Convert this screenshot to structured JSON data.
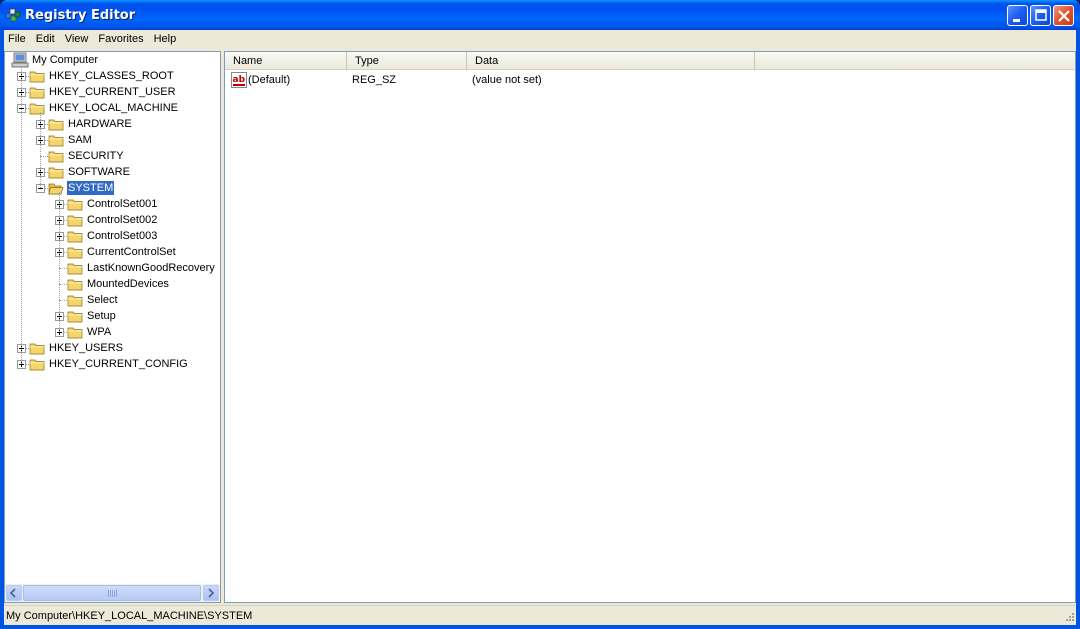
{
  "window": {
    "title": "Registry Editor"
  },
  "menu": [
    "File",
    "Edit",
    "View",
    "Favorites",
    "Help"
  ],
  "tree": {
    "root": "My Computer",
    "nodes": [
      {
        "label": "HKEY_CLASSES_ROOT",
        "depth": 1,
        "expander": "plus"
      },
      {
        "label": "HKEY_CURRENT_USER",
        "depth": 1,
        "expander": "plus"
      },
      {
        "label": "HKEY_LOCAL_MACHINE",
        "depth": 1,
        "expander": "minus"
      },
      {
        "label": "HARDWARE",
        "depth": 2,
        "expander": "plus"
      },
      {
        "label": "SAM",
        "depth": 2,
        "expander": "plus"
      },
      {
        "label": "SECURITY",
        "depth": 2,
        "expander": "none"
      },
      {
        "label": "SOFTWARE",
        "depth": 2,
        "expander": "plus"
      },
      {
        "label": "SYSTEM",
        "depth": 2,
        "expander": "minus",
        "selected": true
      },
      {
        "label": "ControlSet001",
        "depth": 3,
        "expander": "plus"
      },
      {
        "label": "ControlSet002",
        "depth": 3,
        "expander": "plus"
      },
      {
        "label": "ControlSet003",
        "depth": 3,
        "expander": "plus"
      },
      {
        "label": "CurrentControlSet",
        "depth": 3,
        "expander": "plus"
      },
      {
        "label": "LastKnownGoodRecovery",
        "depth": 3,
        "expander": "none"
      },
      {
        "label": "MountedDevices",
        "depth": 3,
        "expander": "none"
      },
      {
        "label": "Select",
        "depth": 3,
        "expander": "none"
      },
      {
        "label": "Setup",
        "depth": 3,
        "expander": "plus"
      },
      {
        "label": "WPA",
        "depth": 3,
        "expander": "plus"
      },
      {
        "label": "HKEY_USERS",
        "depth": 1,
        "expander": "plus"
      },
      {
        "label": "HKEY_CURRENT_CONFIG",
        "depth": 1,
        "expander": "plus"
      }
    ]
  },
  "list": {
    "columns": [
      "Name",
      "Type",
      "Data"
    ],
    "rows": [
      {
        "name": "(Default)",
        "type": "REG_SZ",
        "data": "(value not set)",
        "icon": "string-value-icon"
      }
    ]
  },
  "status": {
    "path": "My Computer\\HKEY_LOCAL_MACHINE\\SYSTEM"
  },
  "colors": {
    "titlebar": "#0054e3",
    "selection": "#316ac5",
    "chrome": "#ece9d8",
    "folder": "#f5d66b"
  }
}
